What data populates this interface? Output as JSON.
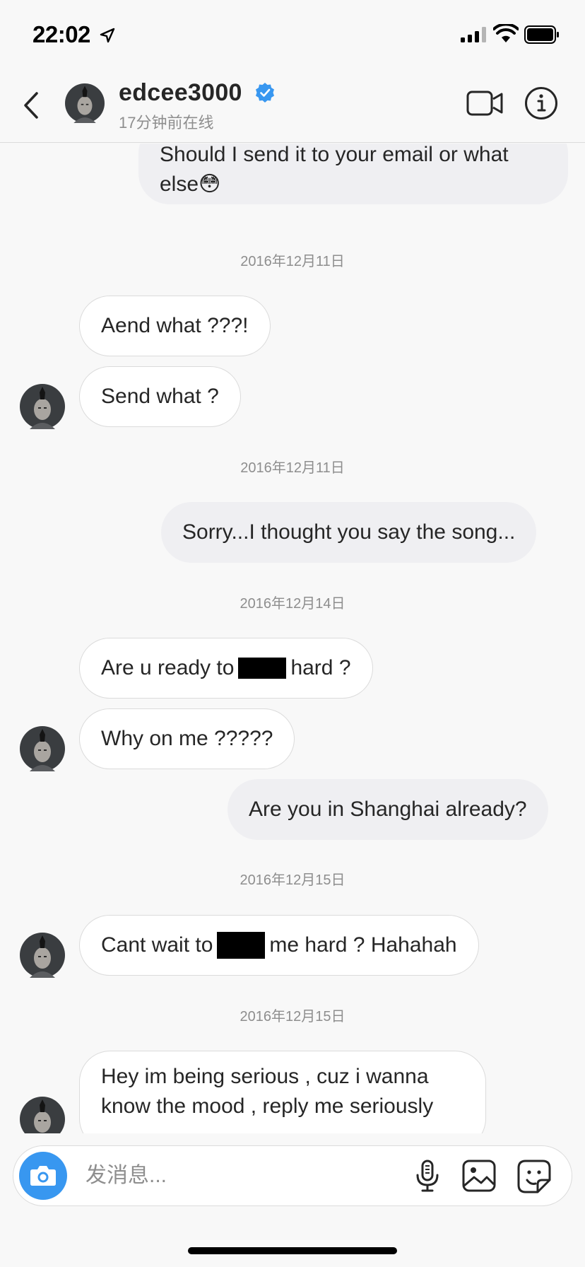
{
  "status_bar": {
    "time": "22:02"
  },
  "header": {
    "username": "edcee3000",
    "presence": "17分钟前在线",
    "icons": [
      "back-icon",
      "verified-icon",
      "video-call-icon",
      "info-icon"
    ]
  },
  "thread": {
    "msg1": "Should I send it to your email or what else😳",
    "date1": "2016年12月11日",
    "msg2": "Aend what ???!",
    "msg3": "Send what ?",
    "date2": "2016年12月11日",
    "msg4": "Sorry...I thought you say the song...",
    "date3": "2016年12月14日",
    "msg5_a": "Are u ready to",
    "msg5_b": "hard ?",
    "msg6": "Why on me ?????",
    "msg7": "Are you in Shanghai already?",
    "date4": "2016年12月15日",
    "msg8_a": "Cant wait to",
    "msg8_b": "me hard ? Hahahah",
    "date5": "2016年12月15日",
    "msg9": "Hey im being serious , cuz i wanna know the mood , reply me seriously"
  },
  "composer": {
    "placeholder": "发消息...",
    "icons": [
      "camera-icon",
      "microphone-icon",
      "gallery-icon",
      "sticker-icon"
    ]
  },
  "colors": {
    "accent": "#3897f0",
    "verified": "#3897f0",
    "outgoing_bubble": "#efeff2",
    "incoming_border": "#dbdbdb",
    "meta_text": "#8e8e8e"
  }
}
